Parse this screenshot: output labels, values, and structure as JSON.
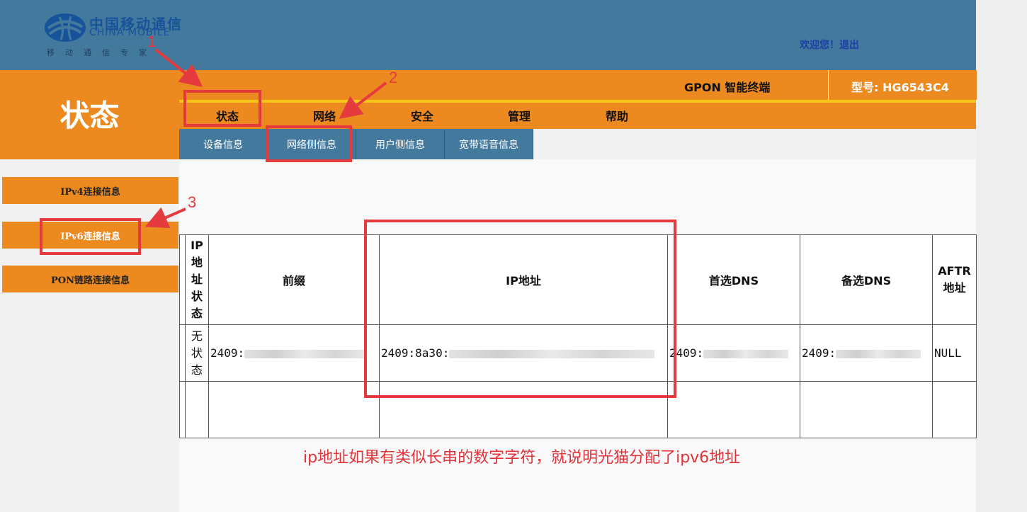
{
  "header": {
    "logo_zh": "中国移动通信",
    "logo_en": "CHINA MOBILE",
    "logo_tagline": "移动通信专家",
    "welcome": "欢迎您！退出"
  },
  "device": {
    "gpon_label": "GPON 智能终端",
    "model_label": "型号: HG6543C4"
  },
  "section_title": "状态",
  "nav": {
    "items": [
      "状态",
      "网络",
      "安全",
      "管理",
      "帮助"
    ]
  },
  "subnav": {
    "tabs": [
      "设备信息",
      "网络侧信息",
      "用户侧信息",
      "宽带语音信息"
    ]
  },
  "sidebar": {
    "items": [
      "IPv4连接信息",
      "IPv6连接信息",
      "PON链路连接信息"
    ]
  },
  "table": {
    "headers": [
      "IP地址状态",
      "前缀",
      "IP地址",
      "首选DNS",
      "备选DNS",
      "AFTR地址"
    ],
    "rows": [
      [
        "无状态",
        "2409:",
        "2409:8a30:",
        "2409:",
        "2409:",
        "NULL"
      ],
      [
        "",
        "",
        "",
        "",
        "",
        ""
      ]
    ]
  },
  "annotations": {
    "labels": [
      "1",
      "2",
      "3"
    ],
    "note": "ip地址如果有类似长串的数字字符，就说明光猫分配了ipv6地址"
  },
  "colors": {
    "header_blue": "#44799e",
    "orange": "#ec8a20",
    "accent_yellow": "#f7c71b",
    "annotation_red": "#e53a3e"
  }
}
